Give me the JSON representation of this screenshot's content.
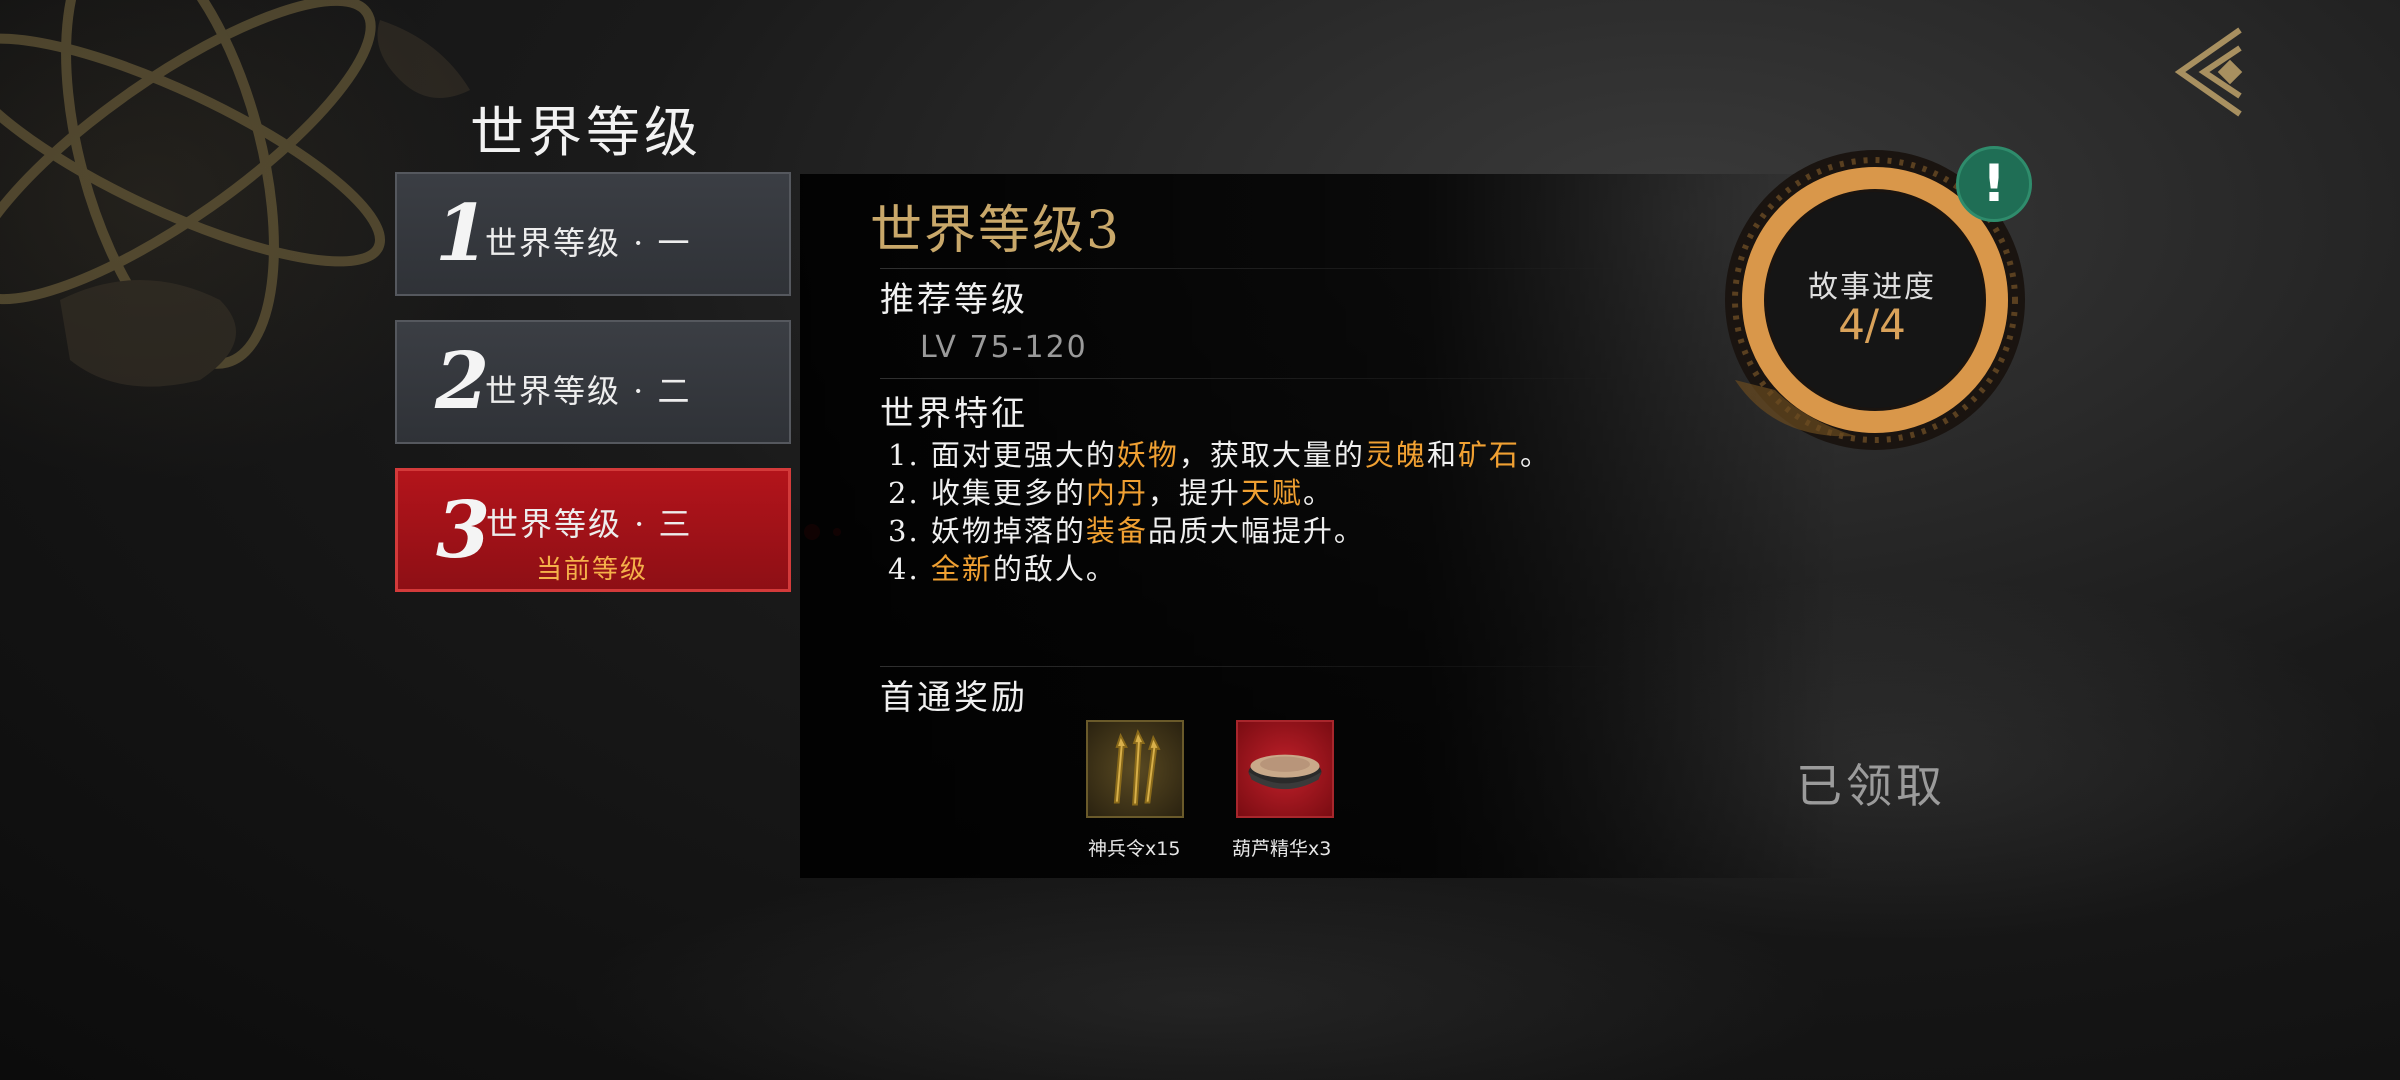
{
  "page_title": "世界等级",
  "tabs": [
    {
      "number": "1",
      "label": "世界等级 · 一"
    },
    {
      "number": "2",
      "label": "世界等级 · 二"
    },
    {
      "number": "3",
      "label": "世界等级 · 三",
      "sub": "当前等级"
    }
  ],
  "detail": {
    "title": "世界等级3",
    "recommended_heading": "推荐等级",
    "level_range": "LV 75-120",
    "features_heading": "世界特征",
    "features": [
      {
        "prefix": "1. 面对更强大的",
        "h1": "妖物",
        "mid1": "，获取大量的",
        "h2": "灵魄",
        "mid2": "和",
        "h3": "矿石",
        "suffix": "。"
      },
      {
        "prefix": "2. 收集更多的",
        "h1": "内丹",
        "mid1": "，提升",
        "h2": "天赋",
        "suffix": "。"
      },
      {
        "prefix": "3. 妖物掉落的",
        "h1": "装备",
        "suffix": "品质大幅提升。"
      },
      {
        "prefix": "4. ",
        "h1": "全新",
        "suffix": "的敌人。"
      }
    ],
    "rewards_heading": "首通奖励",
    "rewards": [
      {
        "name": "神兵令x15",
        "icon": "golden-tokens-icon"
      },
      {
        "name": "葫芦精华x3",
        "icon": "essence-bowl-icon"
      }
    ],
    "claimed_label": "已领取"
  },
  "story_progress": {
    "label": "故事进度",
    "value": "4/4",
    "progress": 1.0
  },
  "alert_symbol": "!",
  "colors": {
    "highlight": "#f0a032",
    "title_gold": "#c9a86a",
    "active_tab": "#b3141b",
    "current_level_text": "#f5b14a",
    "alert_green": "#1f6e55"
  }
}
